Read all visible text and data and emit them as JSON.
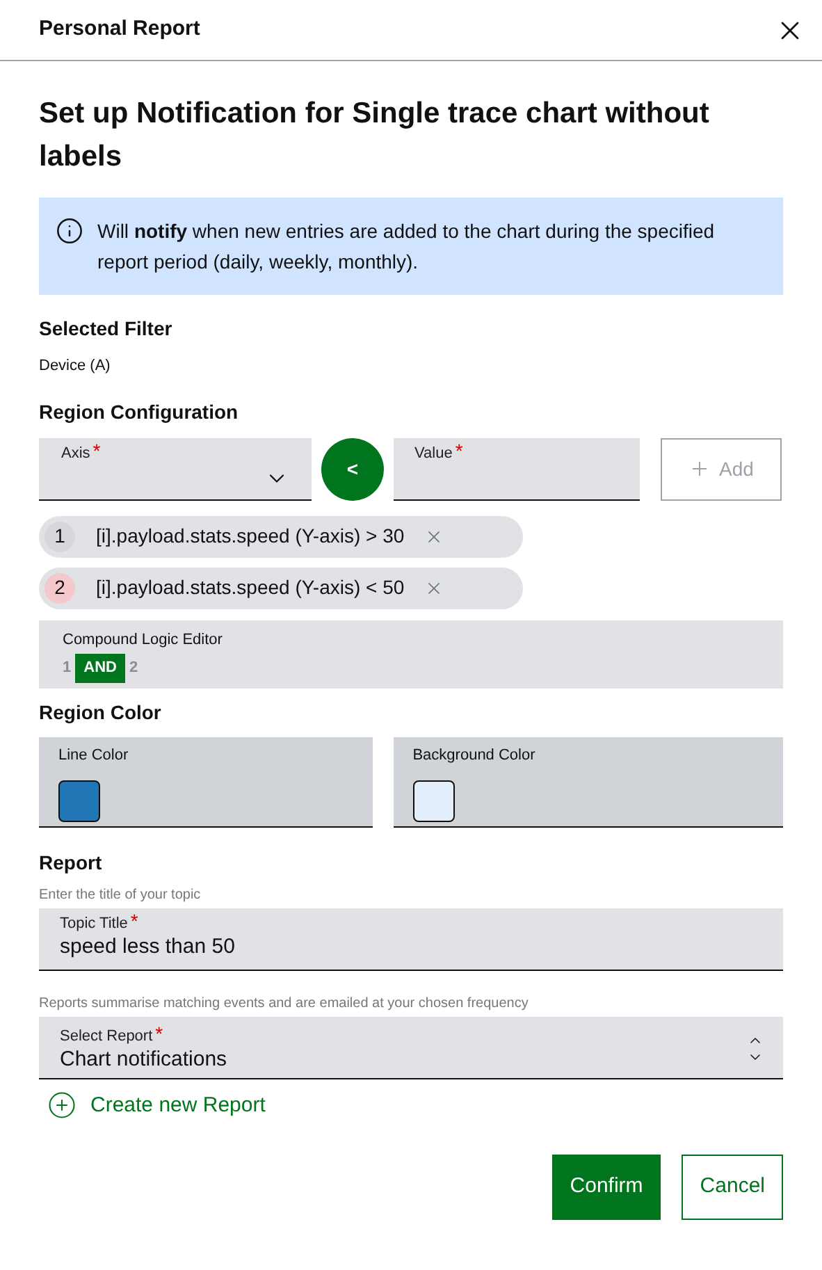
{
  "dialog": {
    "title": "Personal Report"
  },
  "heading": "Set up Notification for Single trace chart without labels",
  "info": "Will **notify** when new entries are added to the chart during the specified report period (daily, weekly, monthly).",
  "selected_filter": {
    "title": "Selected Filter",
    "value": "Device (A)"
  },
  "region_configuration": {
    "title": "Region Configuration",
    "axis_field": {
      "label": "Axis",
      "required_mark": "*"
    },
    "operator": "<",
    "value_field": {
      "label": "Value",
      "required_mark": "*"
    },
    "add_button": {
      "label": "Add",
      "disabled": true
    },
    "conditions": [
      {
        "index": "1",
        "text": "[i].payload.stats.speed (Y-axis) > 30",
        "color": "#d6d7db"
      },
      {
        "index": "2",
        "text": "[i].payload.stats.speed (Y-axis) < 50",
        "color": "#f5c8cb"
      }
    ],
    "compound_logic": {
      "label": "Compound Logic Editor",
      "tokens": [
        {
          "text": "1",
          "kind": "operand"
        },
        {
          "text": "AND",
          "kind": "operator"
        },
        {
          "text": "2",
          "kind": "operand"
        }
      ]
    }
  },
  "region_color": {
    "title": "Region Color",
    "pickers": [
      {
        "label": "Line Color",
        "color": "#2176b5"
      },
      {
        "label": "Background Color",
        "color": "#e3f0fb"
      }
    ]
  },
  "report": {
    "title": "Report",
    "topic_hint": "Enter the title of your topic",
    "topic_field": {
      "label": "Topic Title",
      "required_mark": "*",
      "value": "speed less than 50"
    },
    "report_hint": "Reports summarise matching events and are emailed at your chosen frequency",
    "report_select": {
      "label": "Select Report",
      "required_mark": "*",
      "value": "Chart notifications"
    },
    "create_link": "Create new Report"
  },
  "buttons": [
    {
      "label": "Confirm",
      "kind": "primary"
    },
    {
      "label": "Cancel",
      "kind": "secondary"
    }
  ]
}
